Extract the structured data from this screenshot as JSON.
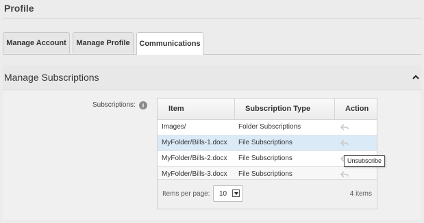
{
  "page": {
    "title": "Profile"
  },
  "tabs": [
    {
      "label": "Manage Account"
    },
    {
      "label": "Manage Profile"
    },
    {
      "label": "Communications",
      "active": true
    }
  ],
  "section": {
    "title": "Manage Subscriptions"
  },
  "subscriptions": {
    "label": "Subscriptions:",
    "columns": [
      "Item",
      "Subscription Type",
      "Action"
    ],
    "rows": [
      {
        "item": "Images/",
        "type": "Folder Subscriptions",
        "action_icon": "unsubscribe-arrow-icon"
      },
      {
        "item": "MyFolder/Bills-1.docx",
        "type": "File Subscriptions",
        "action_icon": "unsubscribe-arrow-icon",
        "selected": true
      },
      {
        "item": "MyFolder/Bills-2.docx",
        "type": "File Subscriptions",
        "action_icon": "unsubscribe-arrow-icon"
      },
      {
        "item": "MyFolder/Bills-3.docx",
        "type": "File Subscriptions",
        "action_icon": "unsubscribe-arrow-icon"
      }
    ],
    "footer": {
      "items_per_page_label": "Items per page:",
      "items_per_page_value": "10",
      "count": "4 items"
    }
  },
  "tooltip": "Unsubscribe",
  "colors": {
    "selected_row": "#dbeaf7",
    "background": "#ececec"
  }
}
